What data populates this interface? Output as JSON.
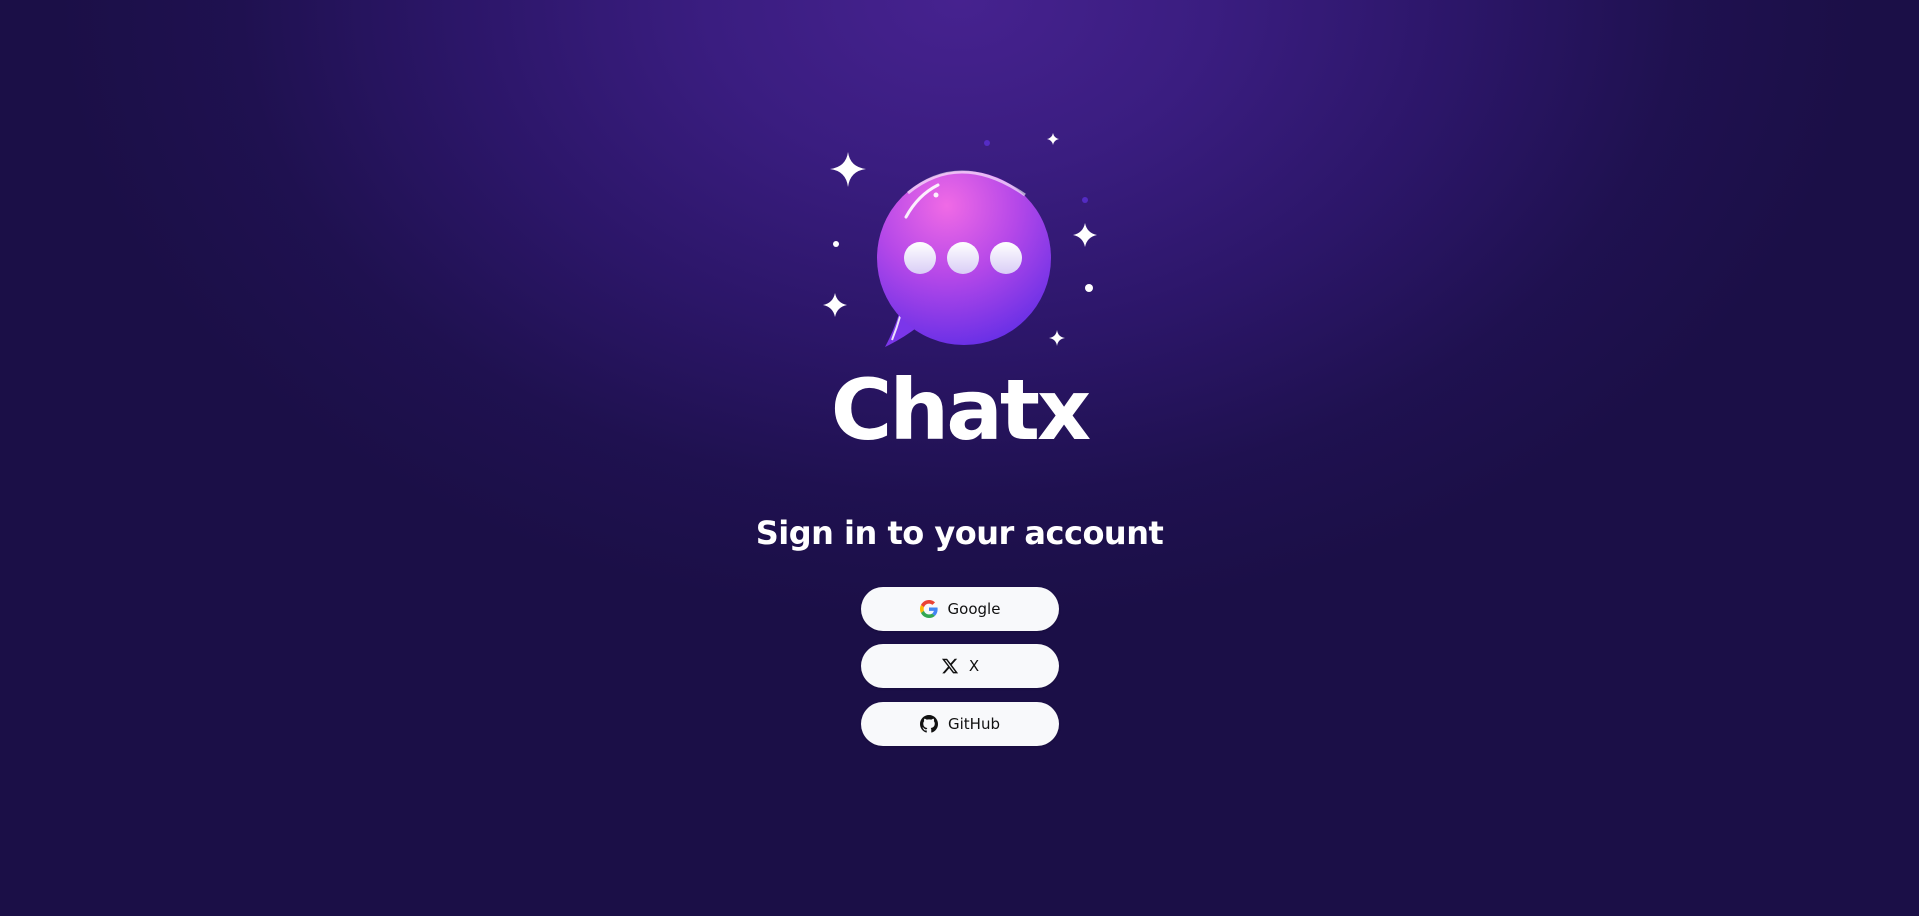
{
  "app": {
    "wordmark": "Chatx"
  },
  "signin": {
    "heading": "Sign in to your account",
    "providers": [
      {
        "label": "Google",
        "icon": "google-icon"
      },
      {
        "label": "X",
        "icon": "x-icon"
      },
      {
        "label": "GitHub",
        "icon": "github-icon"
      }
    ]
  },
  "colors": {
    "background_top": "#46228f",
    "background_bottom": "#1b0f47",
    "button_bg": "#f8f9fb",
    "bubble_top": "#e45ee0",
    "bubble_bottom": "#6a2fe8"
  }
}
